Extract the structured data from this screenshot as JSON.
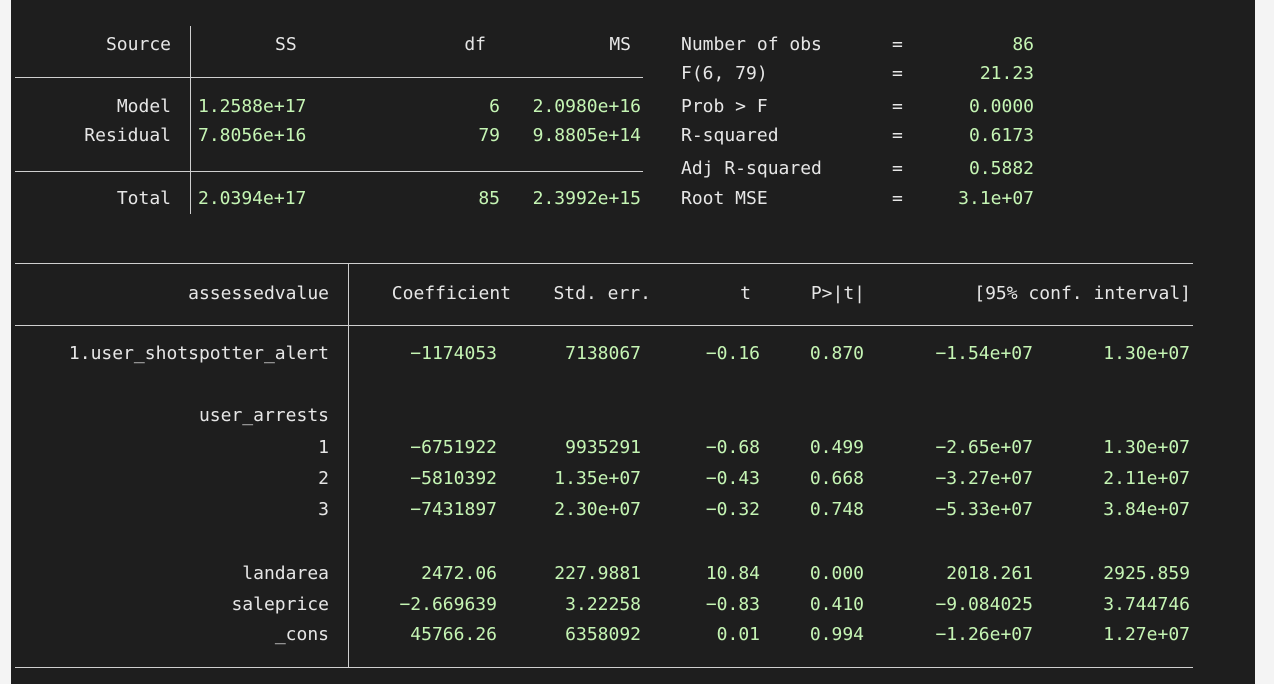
{
  "anova": {
    "header": {
      "source": "Source",
      "ss": "SS",
      "df": "df",
      "ms": "MS"
    },
    "rows": [
      {
        "label": "Model",
        "ss": "1.2588e+17",
        "df": "6",
        "ms": "2.0980e+16"
      },
      {
        "label": "Residual",
        "ss": "7.8056e+16",
        "df": "79",
        "ms": "9.8805e+14"
      },
      {
        "label": "Total",
        "ss": "2.0394e+17",
        "df": "85",
        "ms": "2.3992e+15"
      }
    ]
  },
  "stats": [
    {
      "label": "Number of obs",
      "eq": "=",
      "value": "86"
    },
    {
      "label": "F(6, 79)",
      "eq": "=",
      "value": "21.23"
    },
    {
      "label": "Prob > F",
      "eq": "=",
      "value": "0.0000"
    },
    {
      "label": "R-squared",
      "eq": "=",
      "value": "0.6173"
    },
    {
      "label": "Adj R-squared",
      "eq": "=",
      "value": "0.5882"
    },
    {
      "label": "Root MSE",
      "eq": "=",
      "value": "3.1e+07"
    }
  ],
  "coef": {
    "header": {
      "depvar": "assessedvalue",
      "coefficient": "Coefficient",
      "stderr": "Std. err.",
      "t": "t",
      "p": "P>|t|",
      "ci": "[95% conf. interval]"
    },
    "rows": [
      {
        "label": "1.user_shotspotter_alert",
        "coef": "−1174053",
        "se": "7138067",
        "t": "−0.16",
        "p": "0.870",
        "lo": "−1.54e+07",
        "hi": "1.30e+07"
      },
      {
        "label": "user_arrests"
      },
      {
        "label": "1",
        "coef": "−6751922",
        "se": "9935291",
        "t": "−0.68",
        "p": "0.499",
        "lo": "−2.65e+07",
        "hi": "1.30e+07"
      },
      {
        "label": "2",
        "coef": "−5810392",
        "se": "1.35e+07",
        "t": "−0.43",
        "p": "0.668",
        "lo": "−3.27e+07",
        "hi": "2.11e+07"
      },
      {
        "label": "3",
        "coef": "−7431897",
        "se": "2.30e+07",
        "t": "−0.32",
        "p": "0.748",
        "lo": "−5.33e+07",
        "hi": "3.84e+07"
      },
      {
        "label": "landarea",
        "coef": "2472.06",
        "se": "227.9881",
        "t": "10.84",
        "p": "0.000",
        "lo": "2018.261",
        "hi": "2925.859"
      },
      {
        "label": "saleprice",
        "coef": "−2.669639",
        "se": "3.22258",
        "t": "−0.83",
        "p": "0.410",
        "lo": "−9.084025",
        "hi": "3.744746"
      },
      {
        "label": "_cons",
        "coef": "45766.26",
        "se": "6358092",
        "t": "0.01",
        "p": "0.994",
        "lo": "−1.26e+07",
        "hi": "1.27e+07"
      }
    ]
  }
}
